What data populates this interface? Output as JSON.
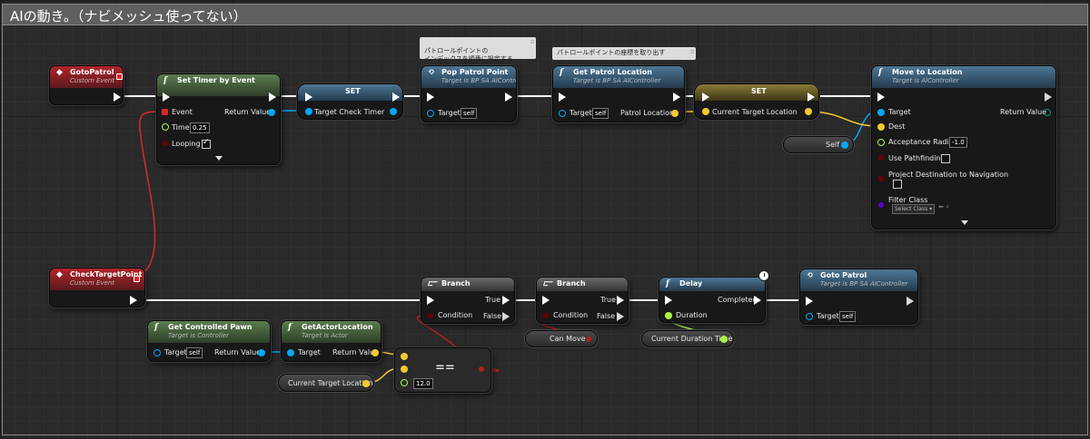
{
  "comment": {
    "title": "AIの動き。（ナビメッシュ使ってない）"
  },
  "bubbles": {
    "pop_patrol_point": "パトロールポイントの\nインデックスを順番に設定する",
    "get_patrol_location": "パトロールポイントの座標を取り出す"
  },
  "nodes": {
    "goto_patrol_event": {
      "title": "GotoPatrol",
      "subtitle": "Custom Event"
    },
    "set_timer_by_event": {
      "icon": "f",
      "title": "Set Timer by Event",
      "event": "Event",
      "return_value": "Return Value",
      "time": "Time",
      "time_value": "0.25",
      "looping": "Looping"
    },
    "set_check_timer": {
      "title": "SET",
      "pin": "Target Check Timer"
    },
    "pop_patrol_point": {
      "title": "Pop Patrol Point",
      "subtitle": "Target is BP SA AIController",
      "target": "Target",
      "target_value": "self"
    },
    "get_patrol_location": {
      "icon": "f",
      "title": "Get Patrol Location",
      "subtitle": "Target is BP SA AIController",
      "target": "Target",
      "target_value": "self",
      "output": "Patrol Location"
    },
    "set_current_target": {
      "title": "SET",
      "pin": "Current Target Location"
    },
    "self_var": {
      "label": "Self"
    },
    "move_to_location": {
      "icon": "f",
      "title": "Move to Location",
      "subtitle": "Target is AIController",
      "target": "Target",
      "return_value": "Return Value",
      "dest": "Dest",
      "acceptance_radius": "Acceptance Radius",
      "acceptance_value": "-1.0",
      "use_pathfinding": "Use Pathfinding",
      "project_destination": "Project Destination to Navigation",
      "filter_class": "Filter Class",
      "select_class": "Select Class"
    },
    "check_target_event": {
      "title": "CheckTargetPoint",
      "subtitle": "Custom Event"
    },
    "branch1": {
      "title": "Branch",
      "condition": "Condition",
      "true_label": "True",
      "false_label": "False"
    },
    "branch2": {
      "title": "Branch",
      "condition": "Condition",
      "true_label": "True",
      "false_label": "False"
    },
    "delay": {
      "icon": "f",
      "title": "Delay",
      "completed": "Completed",
      "duration": "Duration"
    },
    "goto_patrol_call": {
      "title": "Goto Patrol",
      "subtitle": "Target is BP SA AIController",
      "target": "Target",
      "target_value": "self"
    },
    "get_controlled_pawn": {
      "icon": "f",
      "title": "Get Controlled Pawn",
      "subtitle": "Target is Controller",
      "target": "Target",
      "target_value": "self",
      "return_value": "Return Value"
    },
    "get_actor_location": {
      "icon": "f",
      "title": "GetActorLocation",
      "subtitle": "Target is Actor",
      "target": "Target",
      "return_value": "Return Value"
    },
    "equal_node": {
      "symbol": "==",
      "tolerance": "12.0"
    },
    "current_target_var": {
      "label": "Current Target Location"
    },
    "can_move_var": {
      "label": "Can Move"
    },
    "current_duration_var": {
      "label": "Current Duration Time"
    }
  },
  "colors": {
    "exec": "#ffffff",
    "object": "#00a8f4",
    "vector": "#f7c830",
    "float": "#a8f746",
    "bool": "#8b0000",
    "delegate": "#ff3030",
    "class": "#5d00c8"
  }
}
